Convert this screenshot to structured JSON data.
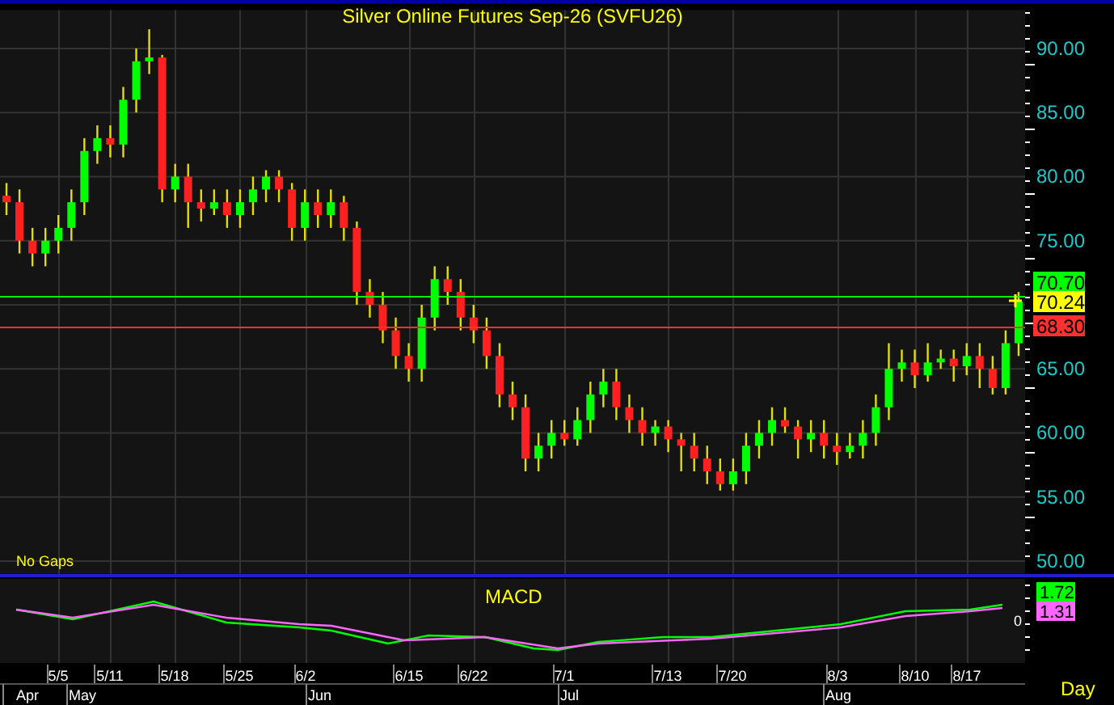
{
  "title": "Silver Online Futures Sep-26 (SVFU26)",
  "price_chart": {
    "chart_data": {
      "type": "candlestick",
      "ylim": [
        49,
        93
      ],
      "grid": true,
      "categories": [
        null,
        null,
        null,
        null,
        "5/5",
        null,
        null,
        null,
        "5/11",
        null,
        null,
        null,
        null,
        "5/18",
        null,
        null,
        null,
        null,
        "5/25",
        null,
        null,
        null,
        null,
        "6/2",
        null,
        null,
        null,
        null,
        null,
        null,
        null,
        "6/15",
        null,
        null,
        null,
        null,
        "6/22",
        null,
        null,
        null,
        null,
        null,
        null,
        "7/1",
        null,
        null,
        null,
        null,
        null,
        null,
        null,
        "7/13",
        null,
        null,
        null,
        null,
        "7/20",
        null,
        null,
        null,
        null,
        null,
        null,
        null,
        "8/3",
        null,
        null,
        null,
        null,
        null,
        "8/10",
        null,
        null,
        null,
        "8/17",
        null,
        null,
        null,
        null
      ],
      "yticks": [
        {
          "value": 90,
          "label": "90.00"
        },
        {
          "value": 85,
          "label": "85.00"
        },
        {
          "value": 80,
          "label": "80.00"
        },
        {
          "value": 75,
          "label": "75.00"
        },
        {
          "value": 65,
          "label": "65.00"
        },
        {
          "value": 60,
          "label": "60.00"
        },
        {
          "value": 55,
          "label": "55.00"
        },
        {
          "value": 50,
          "label": "50.00"
        }
      ],
      "ohlc": [
        [
          78.5,
          79.5,
          77,
          78
        ],
        [
          78,
          79,
          74,
          75
        ],
        [
          75,
          76,
          73,
          74
        ],
        [
          74,
          76,
          73,
          75
        ],
        [
          75,
          77,
          74,
          76
        ],
        [
          76,
          79,
          75,
          78
        ],
        [
          78,
          83,
          77,
          82
        ],
        [
          82,
          84,
          81,
          83
        ],
        [
          83,
          84,
          81.5,
          82.5
        ],
        [
          82.5,
          87,
          81.5,
          86
        ],
        [
          86,
          90,
          85,
          89
        ],
        [
          89,
          91.5,
          88,
          89.3
        ],
        [
          89.3,
          89.5,
          78,
          79
        ],
        [
          79,
          81,
          78,
          80
        ],
        [
          80,
          81,
          76,
          78
        ],
        [
          78,
          79,
          76.5,
          77.5
        ],
        [
          77.5,
          79,
          77,
          78
        ],
        [
          78,
          79,
          76,
          77
        ],
        [
          77,
          79,
          76,
          78
        ],
        [
          78,
          80,
          77,
          79
        ],
        [
          79,
          80.5,
          78,
          80
        ],
        [
          80,
          80.5,
          78,
          79
        ],
        [
          79,
          79.5,
          75,
          76
        ],
        [
          76,
          79,
          75,
          78
        ],
        [
          78,
          79,
          76,
          77
        ],
        [
          77,
          79,
          76,
          78
        ],
        [
          78,
          78.5,
          75,
          76
        ],
        [
          76,
          76.5,
          70,
          71
        ],
        [
          71,
          72,
          69,
          70
        ],
        [
          70,
          71,
          67,
          68
        ],
        [
          68,
          69,
          65,
          66
        ],
        [
          66,
          67,
          64,
          65
        ],
        [
          65,
          70,
          64,
          69
        ],
        [
          69,
          73,
          68,
          72
        ],
        [
          72,
          73,
          70,
          71
        ],
        [
          71,
          72,
          68,
          69
        ],
        [
          69,
          70,
          67,
          68
        ],
        [
          68,
          69,
          65,
          66
        ],
        [
          66,
          67,
          62,
          63
        ],
        [
          63,
          64,
          61,
          62
        ],
        [
          62,
          63,
          57,
          58
        ],
        [
          58,
          60,
          57,
          59
        ],
        [
          59,
          61,
          58,
          60
        ],
        [
          60,
          61,
          59,
          59.5
        ],
        [
          59.5,
          62,
          59,
          61
        ],
        [
          61,
          64,
          60,
          63
        ],
        [
          63,
          65,
          62,
          64
        ],
        [
          64,
          65,
          61,
          62
        ],
        [
          62,
          63,
          60,
          61
        ],
        [
          61,
          62,
          59,
          60
        ],
        [
          60,
          61,
          59,
          60.5
        ],
        [
          60.5,
          61,
          58.5,
          59.5
        ],
        [
          59.5,
          60,
          57,
          59
        ],
        [
          59,
          60,
          57,
          58
        ],
        [
          58,
          59,
          56,
          57
        ],
        [
          57,
          58,
          55.5,
          56
        ],
        [
          56,
          58,
          55.5,
          57
        ],
        [
          57,
          60,
          56,
          59
        ],
        [
          59,
          61,
          58,
          60
        ],
        [
          60,
          62,
          59,
          61
        ],
        [
          61,
          62,
          60,
          60.5
        ],
        [
          60.5,
          61,
          58,
          59.5
        ],
        [
          59.5,
          61,
          58.5,
          60
        ],
        [
          60,
          61,
          58,
          59
        ],
        [
          59,
          60,
          57.5,
          58.5
        ],
        [
          58.5,
          60,
          58,
          59
        ],
        [
          59,
          61,
          58,
          60
        ],
        [
          60,
          63,
          59,
          62
        ],
        [
          62,
          67,
          61,
          65
        ],
        [
          65,
          66.5,
          64,
          65.5
        ],
        [
          65.5,
          66.5,
          63.5,
          64.5
        ],
        [
          64.5,
          67,
          64,
          65.5
        ],
        [
          65.5,
          66.5,
          65,
          65.8
        ],
        [
          65.8,
          66.5,
          64,
          65.2
        ],
        [
          65.2,
          67,
          64.5,
          66
        ],
        [
          66,
          67,
          63.5,
          65
        ],
        [
          65,
          66,
          63,
          63.5
        ],
        [
          63.5,
          68,
          63,
          67
        ],
        [
          67,
          71,
          66,
          70.24
        ]
      ]
    }
  },
  "price_tags": [
    {
      "text": "70.70",
      "color": "#00ff00",
      "kind": "line"
    },
    {
      "text": "70.24",
      "color": "#ffff00",
      "kind": "last"
    },
    {
      "text": "68.30",
      "color": "#ff3030",
      "kind": "line"
    }
  ],
  "gap_label": "No Gaps",
  "macd": {
    "title": "MACD",
    "zero_label": "0",
    "tags": [
      {
        "text": "1.72",
        "color": "#00ff00"
      },
      {
        "text": "1.31",
        "color": "#ff66ff"
      }
    ]
  },
  "date_axis": {
    "months": [
      "Apr",
      "May",
      "Jun",
      "Jul",
      "Aug"
    ]
  },
  "period": "Day"
}
